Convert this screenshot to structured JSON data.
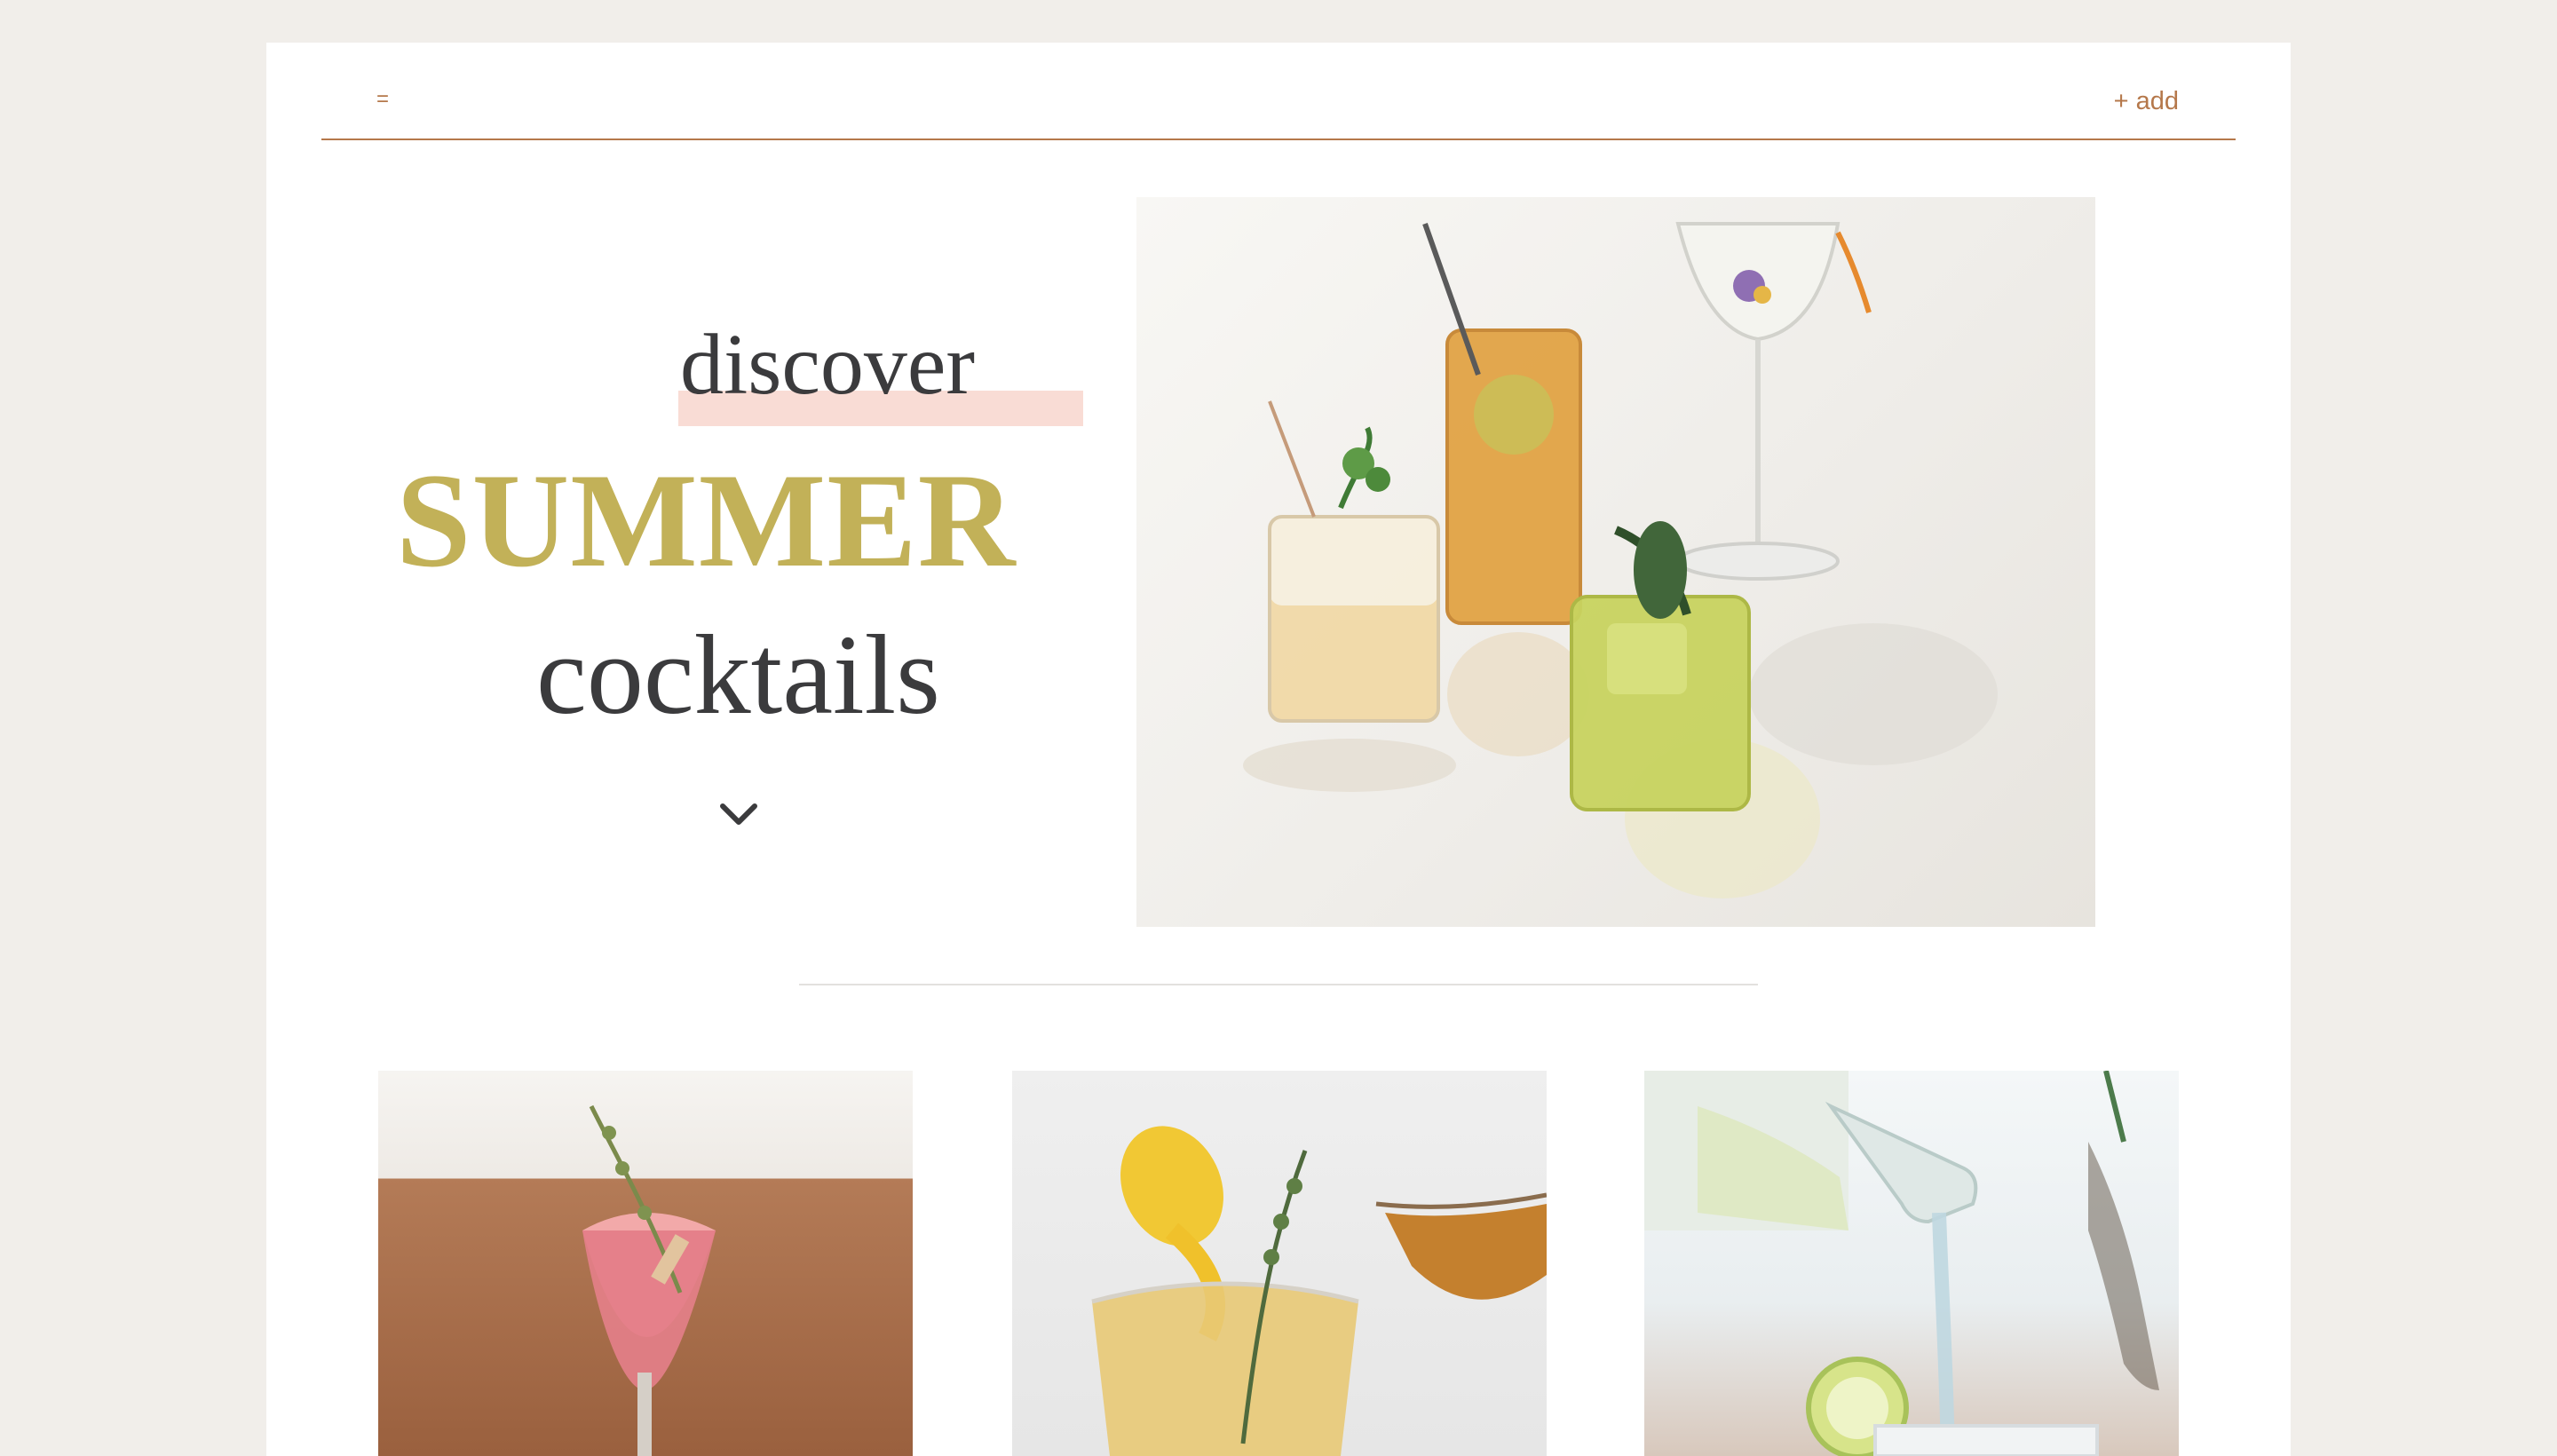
{
  "header": {
    "menu_label": "=",
    "add_label": "+ add"
  },
  "hero": {
    "line1": "discover",
    "line2": "SUMMER",
    "line3": "cocktails",
    "scroll_icon": "chevron-down-icon"
  },
  "colors": {
    "background": "#f1eeea",
    "card": "#ffffff",
    "accent": "#b5784b",
    "highlight": "#f9dcd5",
    "gold": "#c2b158",
    "text": "#3b3b3d"
  },
  "gallery": {
    "items": [
      {
        "image": "pink-coupe-cocktail"
      },
      {
        "image": "lemon-twist-cocktail"
      },
      {
        "image": "sparkling-water-pour"
      }
    ]
  }
}
